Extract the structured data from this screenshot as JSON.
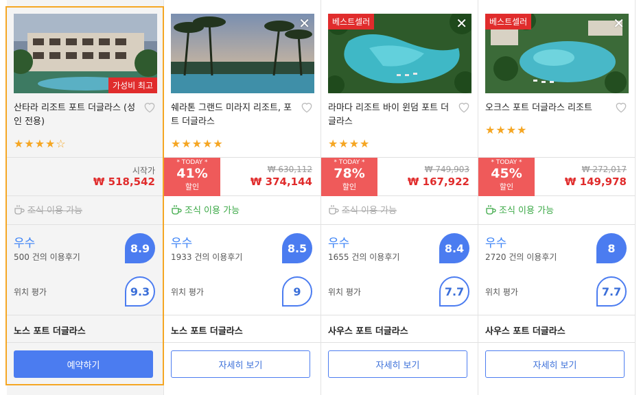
{
  "colors": {
    "accent": "#4b7cf0",
    "sale": "#e02c2c",
    "badge_today": "#ef5a5a",
    "featured_border": "#f5a623",
    "breakfast": "#3aa845"
  },
  "hotels": [
    {
      "name": "산타라 리조트 포트 더글라스 (성인 전용)",
      "image_badge": "가성비 최고",
      "stars": "★★★★☆",
      "price_label": "시작가",
      "price": "₩ 518,542",
      "breakfast": "조식 이용 가능",
      "review_label": "우수",
      "review_count": "500 건의 이용후기",
      "review_score": "8.9",
      "location_label": "위치 평가",
      "location_score": "9.3",
      "area": "노스 포트 더글라스",
      "button": "예약하기"
    },
    {
      "name": "쉐라톤 그랜드 미라지 리조트, 포트 더글라스",
      "stars": "★★★★★",
      "today_label": "* TODAY *",
      "discount": "41%",
      "discount_unit": "할인",
      "old_price": "₩ 630,112",
      "price": "₩ 374,144",
      "breakfast": "조식 이용 가능",
      "review_label": "우수",
      "review_count": "1933 건의 이용후기",
      "review_score": "8.5",
      "location_label": "위치 평가",
      "location_score": "9",
      "area": "노스 포트 더글라스",
      "button": "자세히 보기"
    },
    {
      "name": "라마다 리조트 바이 윈덤 포트 더글라스",
      "image_badge": "베스트셀러",
      "stars": "★★★★",
      "today_label": "* TODAY *",
      "discount": "78%",
      "discount_unit": "할인",
      "old_price": "₩ 749,903",
      "price": "₩ 167,922",
      "breakfast": "조식 이용 가능",
      "review_label": "우수",
      "review_count": "1655 건의 이용후기",
      "review_score": "8.4",
      "location_label": "위치 평가",
      "location_score": "7.7",
      "area": "사우스 포트 더글라스",
      "button": "자세히 보기"
    },
    {
      "name": "오크스 포트 더글라스 리조트",
      "image_badge": "베스트셀러",
      "stars": "★★★★",
      "today_label": "* TODAY *",
      "discount": "45%",
      "discount_unit": "할인",
      "old_price": "₩ 272,017",
      "price": "₩ 149,978",
      "breakfast": "조식 이용 가능",
      "review_label": "우수",
      "review_count": "2720 건의 이용후기",
      "review_score": "8",
      "location_label": "위치 평가",
      "location_score": "7.7",
      "area": "사우스 포트 더글라스",
      "button": "자세히 보기"
    }
  ],
  "icons": {
    "close": "close-icon",
    "heart": "heart-icon",
    "coffee": "coffee-icon"
  }
}
